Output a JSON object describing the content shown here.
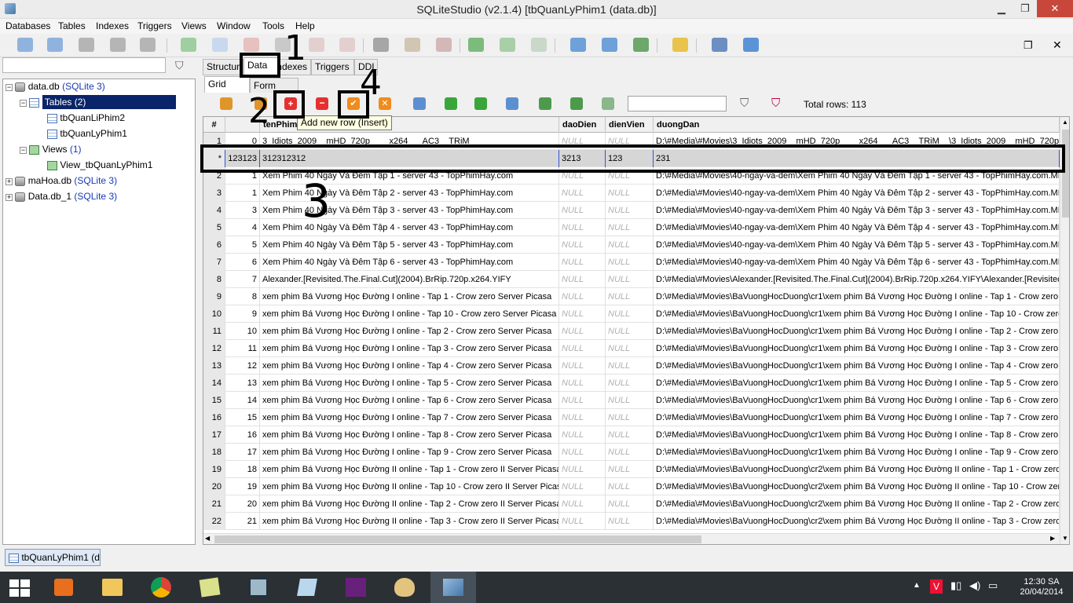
{
  "window": {
    "title": "SQLiteStudio (v2.1.4) [tbQuanLyPhim1 (data.db)]",
    "minimize": "▁",
    "restore": "❐",
    "close": "✕"
  },
  "menu": [
    "Databases",
    "Tables",
    "Indexes",
    "Triggers",
    "Views",
    "Window",
    "Tools",
    "Help"
  ],
  "tree": {
    "data_db": "data.db",
    "data_db_type": "(SQLite 3)",
    "tables": "Tables",
    "tables_count": "(2)",
    "table1": "tbQuanLiPhim2",
    "table2": "tbQuanLyPhim1",
    "views": "Views",
    "views_count": "(1)",
    "view1": "View_tbQuanLyPhim1",
    "mahoa": "maHoa.db",
    "mahoa_type": "(SQLite 3)",
    "datadb1": "Data.db_1",
    "datadb1_type": "(SQLite 3)"
  },
  "tabs": [
    "Structure",
    "Data",
    "Indexes",
    "Triggers",
    "DDL"
  ],
  "subtabs": [
    "Grid view",
    "Form view"
  ],
  "total_rows": "Total rows: 113",
  "tooltip": "Add new row (Insert)",
  "columns": [
    "#",
    "",
    "tenPhim",
    "daoDien",
    "dienVien",
    "duongDan"
  ],
  "new_row": {
    "marker": "*",
    "id": "123123",
    "tenPhim": "312312312",
    "daoDien": "3213",
    "dienVien": "123",
    "duongDan": "231"
  },
  "rows": [
    {
      "n": "1",
      "id": "0",
      "ten": "3_Idiots_2009__mHD_720p____x264___AC3__TRiM",
      "dd": "D:\\#Media\\#Movies\\3_Idiots_2009__mHD_720p____x264___AC3__TRiM__\\3_Idiots_2009__mHD_720p"
    },
    {
      "n": "2",
      "id": "1",
      "ten": "Xem Phim 40 Ngày Và Đêm Tập 1 - server 43 - TopPhimHay.com",
      "dd": "D:\\#Media\\#Movies\\40-ngay-va-dem\\Xem Phim 40 Ngày Và Đêm Tập 1 - server 43 - TopPhimHay.com.MP"
    },
    {
      "n": "3",
      "id": "1",
      "ten": "Xem Phim 40 Ngày Và Đêm Tập 2 - server 43 - TopPhimHay.com",
      "dd": "D:\\#Media\\#Movies\\40-ngay-va-dem\\Xem Phim 40 Ngày Và Đêm Tập 2 - server 43 - TopPhimHay.com.MP"
    },
    {
      "n": "4",
      "id": "3",
      "ten": "Xem Phim 40 Ngày Và Đêm Tập 3 - server 43 - TopPhimHay.com",
      "dd": "D:\\#Media\\#Movies\\40-ngay-va-dem\\Xem Phim 40 Ngày Và Đêm Tập 3 - server 43 - TopPhimHay.com.MP"
    },
    {
      "n": "5",
      "id": "4",
      "ten": "Xem Phim 40 Ngày Và Đêm Tập 4 - server 43 - TopPhimHay.com",
      "dd": "D:\\#Media\\#Movies\\40-ngay-va-dem\\Xem Phim 40 Ngày Và Đêm Tập 4 - server 43 - TopPhimHay.com.MP"
    },
    {
      "n": "6",
      "id": "5",
      "ten": "Xem Phim 40 Ngày Và Đêm Tập 5 - server 43 - TopPhimHay.com",
      "dd": "D:\\#Media\\#Movies\\40-ngay-va-dem\\Xem Phim 40 Ngày Và Đêm Tập 5 - server 43 - TopPhimHay.com.MP"
    },
    {
      "n": "7",
      "id": "6",
      "ten": "Xem Phim 40 Ngày Và Đêm Tập 6 - server 43 - TopPhimHay.com",
      "dd": "D:\\#Media\\#Movies\\40-ngay-va-dem\\Xem Phim 40 Ngày Và Đêm Tập 6 - server 43 - TopPhimHay.com.MP"
    },
    {
      "n": "8",
      "id": "7",
      "ten": "Alexander.[Revisited.The.Final.Cut](2004).BrRip.720p.x264.YIFY",
      "dd": "D:\\#Media\\#Movies\\Alexander.[Revisited.The.Final.Cut](2004).BrRip.720p.x264.YIFY\\Alexander.[Revisited"
    },
    {
      "n": "9",
      "id": "8",
      "ten": "xem phim Bá Vương Học Đường I online - Tap 1 - Crow zero Server Picasa",
      "dd": "D:\\#Media\\#Movies\\BaVuongHocDuong\\cr1\\xem phim Bá Vương Học Đường I online - Tap 1 - Crow zero"
    },
    {
      "n": "10",
      "id": "9",
      "ten": "xem phim Bá Vương Học Đường I online - Tap 10 - Crow zero Server Picasa",
      "dd": "D:\\#Media\\#Movies\\BaVuongHocDuong\\cr1\\xem phim Bá Vương Học Đường I online - Tap 10 - Crow zero"
    },
    {
      "n": "11",
      "id": "10",
      "ten": "xem phim Bá Vương Học Đường I online - Tap 2 - Crow zero Server Picasa",
      "dd": "D:\\#Media\\#Movies\\BaVuongHocDuong\\cr1\\xem phim Bá Vương Học Đường I online - Tap 2 - Crow zero"
    },
    {
      "n": "12",
      "id": "11",
      "ten": "xem phim Bá Vương Học Đường I online - Tap 3 - Crow zero Server Picasa",
      "dd": "D:\\#Media\\#Movies\\BaVuongHocDuong\\cr1\\xem phim Bá Vương Học Đường I online - Tap 3 - Crow zero"
    },
    {
      "n": "13",
      "id": "12",
      "ten": "xem phim Bá Vương Học Đường I online - Tap 4 - Crow zero Server Picasa",
      "dd": "D:\\#Media\\#Movies\\BaVuongHocDuong\\cr1\\xem phim Bá Vương Học Đường I online - Tap 4 - Crow zero"
    },
    {
      "n": "14",
      "id": "13",
      "ten": "xem phim Bá Vương Học Đường I online - Tap 5 - Crow zero Server Picasa",
      "dd": "D:\\#Media\\#Movies\\BaVuongHocDuong\\cr1\\xem phim Bá Vương Học Đường I online - Tap 5 - Crow zero"
    },
    {
      "n": "15",
      "id": "14",
      "ten": "xem phim Bá Vương Học Đường I online - Tap 6 - Crow zero Server Picasa",
      "dd": "D:\\#Media\\#Movies\\BaVuongHocDuong\\cr1\\xem phim Bá Vương Học Đường I online - Tap 6 - Crow zero"
    },
    {
      "n": "16",
      "id": "15",
      "ten": "xem phim Bá Vương Học Đường I online - Tap 7 - Crow zero Server Picasa",
      "dd": "D:\\#Media\\#Movies\\BaVuongHocDuong\\cr1\\xem phim Bá Vương Học Đường I online - Tap 7 - Crow zero"
    },
    {
      "n": "17",
      "id": "16",
      "ten": "xem phim Bá Vương Học Đường I online - Tap 8 - Crow zero Server Picasa",
      "dd": "D:\\#Media\\#Movies\\BaVuongHocDuong\\cr1\\xem phim Bá Vương Học Đường I online - Tap 8 - Crow zero"
    },
    {
      "n": "18",
      "id": "17",
      "ten": "xem phim Bá Vương Học Đường I online - Tap 9 - Crow zero Server Picasa",
      "dd": "D:\\#Media\\#Movies\\BaVuongHocDuong\\cr1\\xem phim Bá Vương Học Đường I online - Tap 9 - Crow zero"
    },
    {
      "n": "19",
      "id": "18",
      "ten": "xem phim Bá Vương Học Đường II online - Tap 1 - Crow zero II Server Picasa",
      "dd": "D:\\#Media\\#Movies\\BaVuongHocDuong\\cr2\\xem phim Bá Vương Học Đường II online - Tap 1 - Crow zero"
    },
    {
      "n": "20",
      "id": "19",
      "ten": "xem phim Bá Vương Học Đường II online - Tap 10 - Crow zero II Server Picasa",
      "dd": "D:\\#Media\\#Movies\\BaVuongHocDuong\\cr2\\xem phim Bá Vương Học Đường II online - Tap 10 - Crow zero"
    },
    {
      "n": "21",
      "id": "20",
      "ten": "xem phim Bá Vương Học Đường II online - Tap 2 - Crow zero II Server Picasa",
      "dd": "D:\\#Media\\#Movies\\BaVuongHocDuong\\cr2\\xem phim Bá Vương Học Đường II online - Tap 2 - Crow zero"
    },
    {
      "n": "22",
      "id": "21",
      "ten": "xem phim Bá Vương Học Đường II online - Tap 3 - Crow zero II Server Picasa",
      "dd": "D:\\#Media\\#Movies\\BaVuongHocDuong\\cr2\\xem phim Bá Vương Học Đường II online - Tap 3 - Crow zero"
    }
  ],
  "null_text": "NULL",
  "annotations": [
    "1",
    "2",
    "3",
    "4"
  ],
  "status_tab": "tbQuanLyPhim1 (d",
  "clock": {
    "time": "12:30 SA",
    "date": "20/04/2014"
  },
  "colors": {
    "accent_select": "#1a38b3",
    "close_red": "#c7473b",
    "taskbar": "#2b3035"
  }
}
